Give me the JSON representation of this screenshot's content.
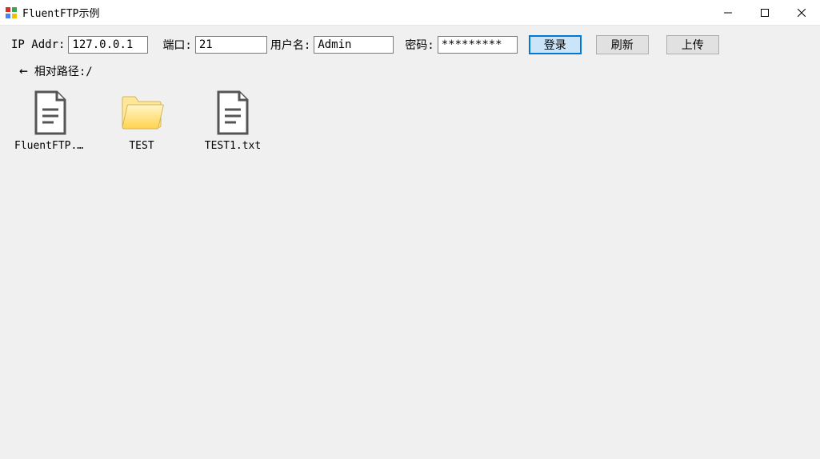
{
  "window": {
    "title": "FluentFTP示例"
  },
  "toolbar": {
    "ip_label": "IP Addr:",
    "ip_value": "127.0.0.1",
    "port_label": "端口:",
    "port_value": "21",
    "user_label": "用户名:",
    "user_value": "Admin",
    "pass_label": "密码:",
    "pass_value": "*********",
    "login_label": "登录",
    "refresh_label": "刷新",
    "upload_label": "上传"
  },
  "path": {
    "label_prefix": "相对路径:",
    "value": "/"
  },
  "files": [
    {
      "name": "FluentFTP.xml",
      "display": "FluentFTP.xm.",
      "type": "file"
    },
    {
      "name": "TEST",
      "display": "TEST",
      "type": "folder"
    },
    {
      "name": "TEST1.txt",
      "display": "TEST1.txt",
      "type": "file"
    }
  ]
}
